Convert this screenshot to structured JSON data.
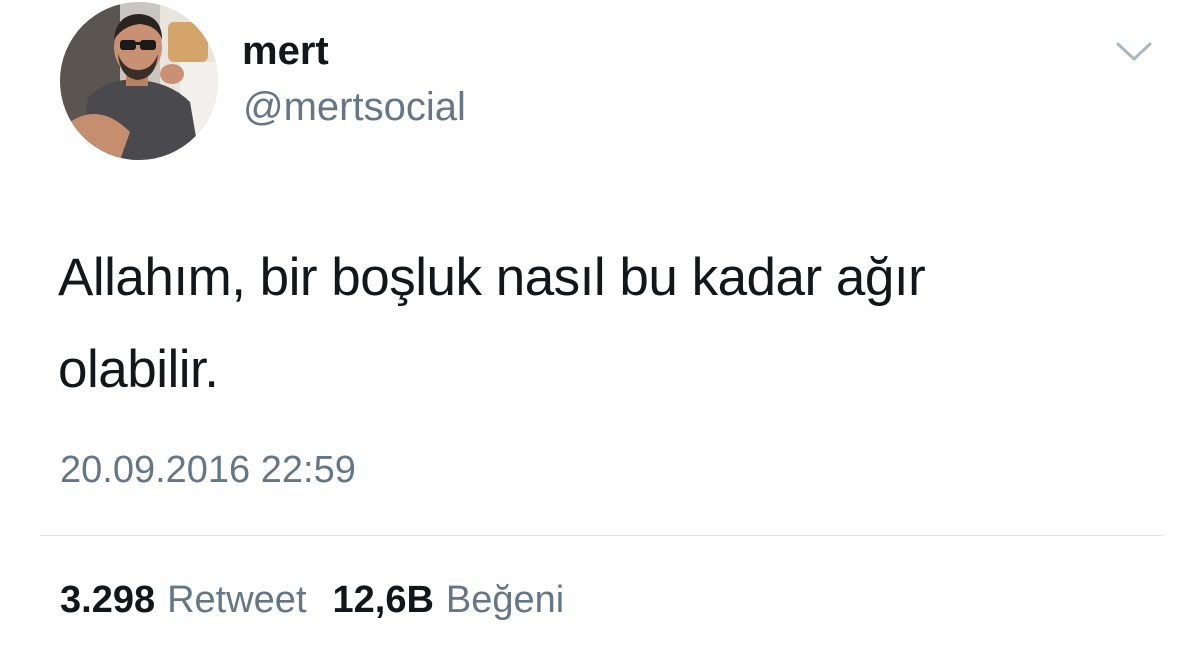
{
  "user": {
    "display_name": "mert",
    "handle": "@mertsocial",
    "avatar": "profile-photo"
  },
  "tweet": {
    "text": "Allahım, bir boşluk nasıl bu kadar ağır\nolabilir.",
    "timestamp": "20.09.2016 22:59"
  },
  "stats": {
    "retweets": {
      "count": "3.298",
      "label": "Retweet"
    },
    "likes": {
      "count": "12,6B",
      "label": "Beğeni"
    }
  },
  "icons": {
    "menu": "chevron-down-icon"
  },
  "colors": {
    "text": "#14171a",
    "secondary": "#657786",
    "divider": "#e1e8ed"
  }
}
